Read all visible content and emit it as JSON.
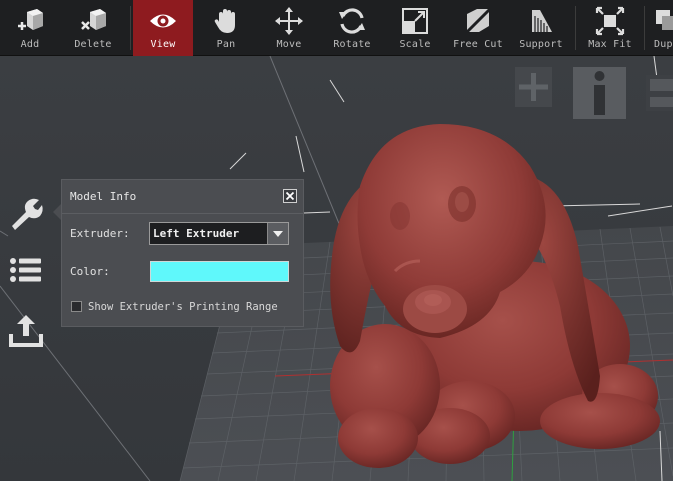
{
  "toolbar": {
    "items": [
      {
        "label": "Add",
        "icon": "add-cube-icon"
      },
      {
        "label": "Delete",
        "icon": "delete-cube-icon"
      },
      {
        "label": "View",
        "icon": "eye-icon",
        "active": true
      },
      {
        "label": "Pan",
        "icon": "hand-icon"
      },
      {
        "label": "Move",
        "icon": "move-arrows-icon"
      },
      {
        "label": "Rotate",
        "icon": "rotate-icon"
      },
      {
        "label": "Scale",
        "icon": "scale-icon"
      },
      {
        "label": "Free Cut",
        "icon": "free-cut-icon"
      },
      {
        "label": "Support",
        "icon": "support-icon"
      },
      {
        "label": "Max Fit",
        "icon": "max-fit-icon"
      },
      {
        "label": "Dupl",
        "icon": "duplicate-icon"
      }
    ],
    "active_color": "#8e1b1f"
  },
  "side_icons": [
    "wrench-icon",
    "list-icon",
    "upload-icon"
  ],
  "right_icons": [
    "plus-icon",
    "info-icon",
    "save-icon"
  ],
  "model_info": {
    "title": "Model Info",
    "extruder_label": "Extruder:",
    "extruder_value": "Left Extruder",
    "color_label": "Color:",
    "color_value": "#5ff8fb",
    "checkbox_label": "Show Extruder's Printing Range",
    "checkbox_checked": false
  },
  "model": {
    "color": "#8e3a36"
  }
}
